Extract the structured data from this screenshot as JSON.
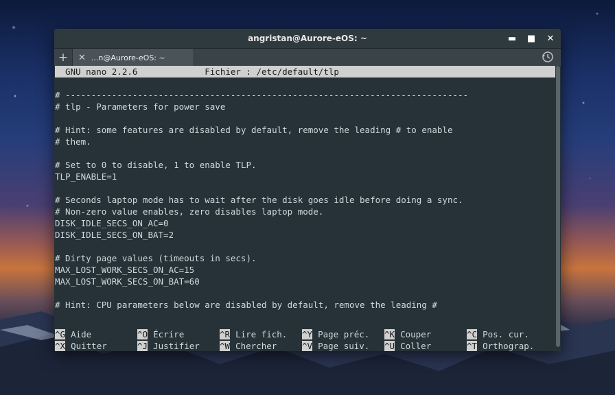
{
  "window": {
    "title": "angristan@Aurore-eOS: ~",
    "controls": {
      "minimize": "▬",
      "maximize": "■",
      "close": "✕"
    }
  },
  "tabs": {
    "add_label": "+",
    "close_label": "✕",
    "items": [
      {
        "label": "...n@Aurore-eOS: ~"
      }
    ]
  },
  "nano": {
    "header": "  GNU nano 2.2.6             Fichier : /etc/default/tlp",
    "lines": [
      "",
      "# ------------------------------------------------------------------------------",
      "# tlp - Parameters for power save",
      "",
      "# Hint: some features are disabled by default, remove the leading # to enable",
      "# them.",
      "",
      "# Set to 0 to disable, 1 to enable TLP.",
      "TLP_ENABLE=1",
      "",
      "# Seconds laptop mode has to wait after the disk goes idle before doing a sync.",
      "# Non-zero value enables, zero disables laptop mode.",
      "DISK_IDLE_SECS_ON_AC=0",
      "DISK_IDLE_SECS_ON_BAT=2",
      "",
      "# Dirty page values (timeouts in secs).",
      "MAX_LOST_WORK_SECS_ON_AC=15",
      "MAX_LOST_WORK_SECS_ON_BAT=60",
      "",
      "# Hint: CPU parameters below are disabled by default, remove the leading #"
    ],
    "shortcuts": [
      [
        {
          "key": "^G",
          "label": "Aide"
        },
        {
          "key": "^O",
          "label": "Écrire"
        },
        {
          "key": "^R",
          "label": "Lire fich."
        },
        {
          "key": "^Y",
          "label": "Page préc."
        },
        {
          "key": "^K",
          "label": "Couper"
        },
        {
          "key": "^C",
          "label": "Pos. cur."
        }
      ],
      [
        {
          "key": "^X",
          "label": "Quitter"
        },
        {
          "key": "^J",
          "label": "Justifier"
        },
        {
          "key": "^W",
          "label": "Chercher"
        },
        {
          "key": "^V",
          "label": "Page suiv."
        },
        {
          "key": "^U",
          "label": "Coller"
        },
        {
          "key": "^T",
          "label": "Orthograp."
        }
      ]
    ]
  },
  "colors": {
    "terminal_bg": "#263238",
    "terminal_fg": "#cfd8dc",
    "highlight_bg": "#d0d0d0"
  },
  "icons": {
    "history": "history-icon"
  }
}
